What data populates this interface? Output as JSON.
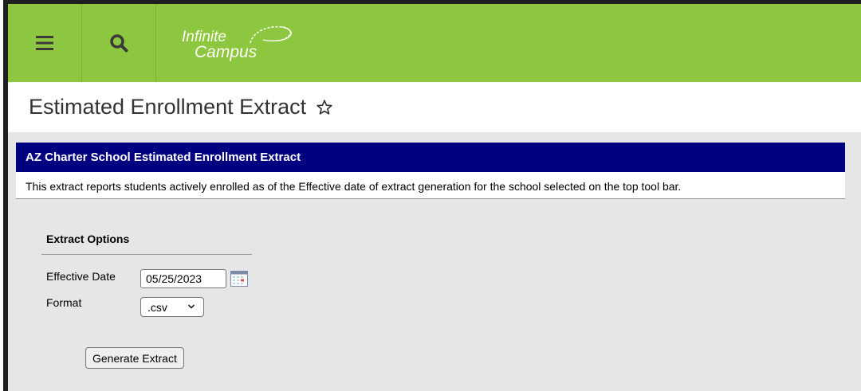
{
  "header": {
    "logo_line1": "Infinite",
    "logo_line2": "Campus",
    "menu_icon": "hamburger-menu-icon",
    "search_icon": "search-icon",
    "bar_color": "#8dc63f"
  },
  "page": {
    "title": "Estimated Enrollment Extract",
    "favorite_icon": "star-outline-icon"
  },
  "panel": {
    "heading": "AZ Charter School Estimated Enrollment Extract",
    "description": "This extract reports students actively enrolled as of the Effective date of extract generation for the school selected on the top tool bar.",
    "header_color": "#000080"
  },
  "extract_options": {
    "title": "Extract Options",
    "effective_date_label": "Effective Date",
    "effective_date_value": "05/25/2023",
    "format_label": "Format",
    "format_value": ".csv",
    "generate_label": "Generate Extract"
  }
}
